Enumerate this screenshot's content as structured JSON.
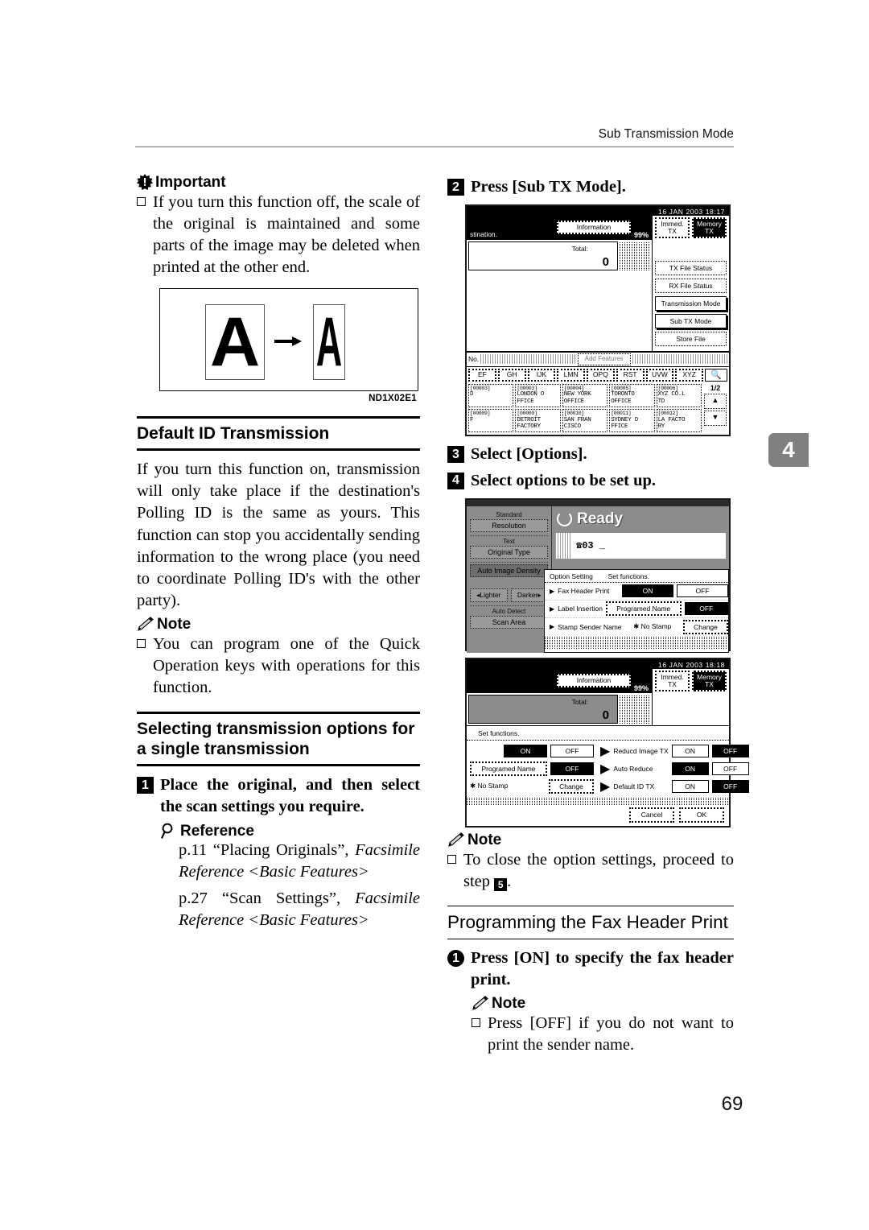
{
  "header": {
    "running_head": "Sub Transmission Mode"
  },
  "chapter_tab": "4",
  "page_number": "69",
  "left": {
    "important": {
      "label": "Important",
      "bullets": [
        "If you turn this function off, the scale of the original is maintained and some parts of the image may be deleted when printed at the other end."
      ]
    },
    "figure": {
      "left_glyph": "A",
      "right_glyph": "A",
      "caption": "ND1X02E1"
    },
    "section_default_id": {
      "title": "Default ID Transmission",
      "paragraph": "If you turn this function on, transmission will only take place if the destination's Polling ID is the same as yours. This function can stop you accidentally sending information to the wrong place (you need to coordinate Polling ID's with the other party).",
      "note_label": "Note",
      "note_bullets": [
        "You can program one of the Quick Operation keys with operations for this function."
      ]
    },
    "section_selecting": {
      "title": "Selecting transmission options for a single transmission",
      "step1_num": "1",
      "step1_text": "Place the original, and then select the scan settings you require.",
      "reference_label": "Reference",
      "reference_items": [
        {
          "plain": "p.11 “Placing Originals”, ",
          "italic": "Facsimile Reference <Basic Features>"
        },
        {
          "plain": "p.27 “Scan Settings”, ",
          "italic": "Facsimile Reference <Basic Features>"
        }
      ]
    }
  },
  "right": {
    "step2_num": "2",
    "step2_text": "Press [Sub TX Mode].",
    "step3_num": "3",
    "step3_text": "Select [Options].",
    "step4_num": "4",
    "step4_text": "Select options to be set up.",
    "note_label": "Note",
    "note_bullet_pre": "To close the option settings, proceed to step ",
    "note_bullet_step": "5",
    "note_bullet_post": ".",
    "section_fax_header": {
      "title": "Programming the Fax Header Print",
      "step1_num": "1",
      "step1_text": "Press [ON] to specify the fax header print.",
      "note_label": "Note",
      "note_bullets": [
        "Press [OFF] if you do not want to print the sender name."
      ]
    }
  },
  "lcd_panel_1": {
    "datetime": "16 JAN  2003 18:17",
    "message": "stination.",
    "information_label": "Information",
    "percent": "99%",
    "immed_tx": {
      "line1": "Immed.",
      "line2": "TX"
    },
    "memory_tx": {
      "line1": "Memory",
      "line2": "TX"
    },
    "total_label": "Total:",
    "total_value": "0",
    "no_label": "No.",
    "add_features": "Add Features",
    "alpha_keys": [
      "EF",
      "GH",
      "IJK",
      "LMN",
      "OPQ",
      "RST",
      "UVW",
      "XYZ"
    ],
    "search_icon": "search-icon",
    "page_indicator": "1/2",
    "destinations": [
      {
        "id": "[00003]",
        "l1": "D",
        "l2": ""
      },
      {
        "id": "[00003]",
        "l1": "LONDON O",
        "l2": "FFICE"
      },
      {
        "id": "[00004]",
        "l1": "NEW YORK",
        "l2": "OFFICE"
      },
      {
        "id": "[00005]",
        "l1": "TORONTO",
        "l2": "OFFICE"
      },
      {
        "id": "[00006]",
        "l1": "XYZ CO.L",
        "l2": "TD"
      },
      {
        "id": "[00009]",
        "l1": "F",
        "l2": ""
      },
      {
        "id": "[00009]",
        "l1": "DETROIT",
        "l2": "FACTORY"
      },
      {
        "id": "[00010]",
        "l1": "SAN FRAN",
        "l2": "CISCO"
      },
      {
        "id": "[00011]",
        "l1": "SYDNEY O",
        "l2": "FFICE"
      },
      {
        "id": "[00012]",
        "l1": "LA FACTO",
        "l2": "RY"
      }
    ],
    "side_buttons": [
      "TX File Status",
      "RX File Status",
      "Transmission Mode",
      "Sub TX Mode",
      "Store File"
    ]
  },
  "lcd_panel_2": {
    "ready_label": "Ready",
    "entry_number": "03",
    "left_keys": [
      {
        "caption": "Standard",
        "key": "Resolution"
      },
      {
        "caption": "Text",
        "key": "Original Type"
      }
    ],
    "auto_image_density": "Auto Image Density",
    "lighter": "Lighter",
    "darker": "Darker",
    "auto_detect_caption": "Auto Detect",
    "scan_area": "Scan Area",
    "dialog": {
      "title": "Option Setting",
      "subtitle": "Set functions.",
      "rows": [
        {
          "name": "Fax Header Print",
          "opt_a": "ON",
          "opt_a_state": "on",
          "opt_b": "OFF",
          "opt_b_state": "off"
        },
        {
          "name": "Label Insertion",
          "opt_a": "Programed Name",
          "opt_a_state": "off",
          "opt_b": "OFF",
          "opt_b_state": "on"
        },
        {
          "name": "Stamp Sender Name",
          "opt_a": "✱ No Stamp",
          "opt_a_state": "text",
          "opt_b": "Change",
          "opt_b_state": "off"
        }
      ]
    }
  },
  "lcd_panel_3": {
    "datetime": "16 JAN  2003 18:18",
    "information_label": "Information",
    "percent": "99%",
    "immed_tx": {
      "line1": "Immed.",
      "line2": "TX"
    },
    "memory_tx": {
      "line1": "Memory",
      "line2": "TX"
    },
    "total_label": "Total:",
    "total_value": "0",
    "dialog_title": "Set functions.",
    "left_rows": [
      {
        "name": "",
        "opt_a": "ON",
        "opt_a_state": "on",
        "opt_b": "OFF",
        "opt_b_state": "off"
      },
      {
        "name": "",
        "opt_a": "Programed Name",
        "opt_a_state": "off",
        "opt_b": "OFF",
        "opt_b_state": "on"
      },
      {
        "name": "✱ No Stamp",
        "opt_a": "",
        "opt_a_state": "none",
        "opt_b": "Change",
        "opt_b_state": "off"
      }
    ],
    "right_rows": [
      {
        "name": "Reducd Image TX",
        "opt_a": "ON",
        "opt_a_state": "off",
        "opt_b": "OFF",
        "opt_b_state": "on"
      },
      {
        "name": "Auto Reduce",
        "opt_a": "ON",
        "opt_a_state": "on",
        "opt_b": "OFF",
        "opt_b_state": "off"
      },
      {
        "name": "Default ID TX",
        "opt_a": "ON",
        "opt_a_state": "off",
        "opt_b": "OFF",
        "opt_b_state": "on"
      }
    ],
    "cancel_label": "Cancel",
    "ok_label": "OK"
  }
}
